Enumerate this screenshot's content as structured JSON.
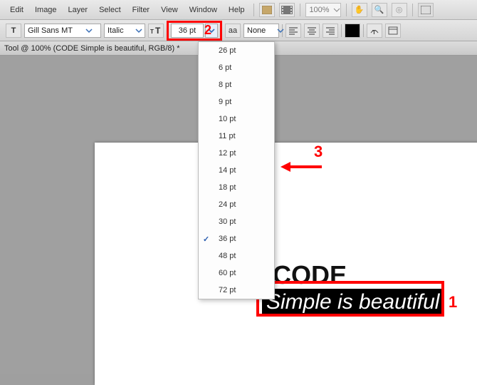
{
  "menubar": {
    "items": [
      "Edit",
      "Image",
      "Layer",
      "Select",
      "Filter",
      "View",
      "Window",
      "Help"
    ],
    "zoom": "100%"
  },
  "optbar": {
    "font_family": "Gill Sans MT",
    "font_style": "Italic",
    "font_size": "36 pt",
    "aa": "None"
  },
  "status": "Tool @ 100% (CODE Simple is beautiful, RGB/8) *",
  "dd": {
    "items": [
      "26 pt",
      "6 pt",
      "8 pt",
      "9 pt",
      "10 pt",
      "11 pt",
      "12 pt",
      "14 pt",
      "18 pt",
      "24 pt",
      "30 pt",
      "36 pt",
      "48 pt",
      "60 pt",
      "72 pt"
    ],
    "selected": "36 pt"
  },
  "canvas": {
    "head": "CODE",
    "sub": "Simple is beautiful"
  },
  "anno": {
    "n1": "1",
    "n2": "2",
    "n3": "3"
  },
  "icons": {
    "text": "T",
    "aa": "aa"
  }
}
